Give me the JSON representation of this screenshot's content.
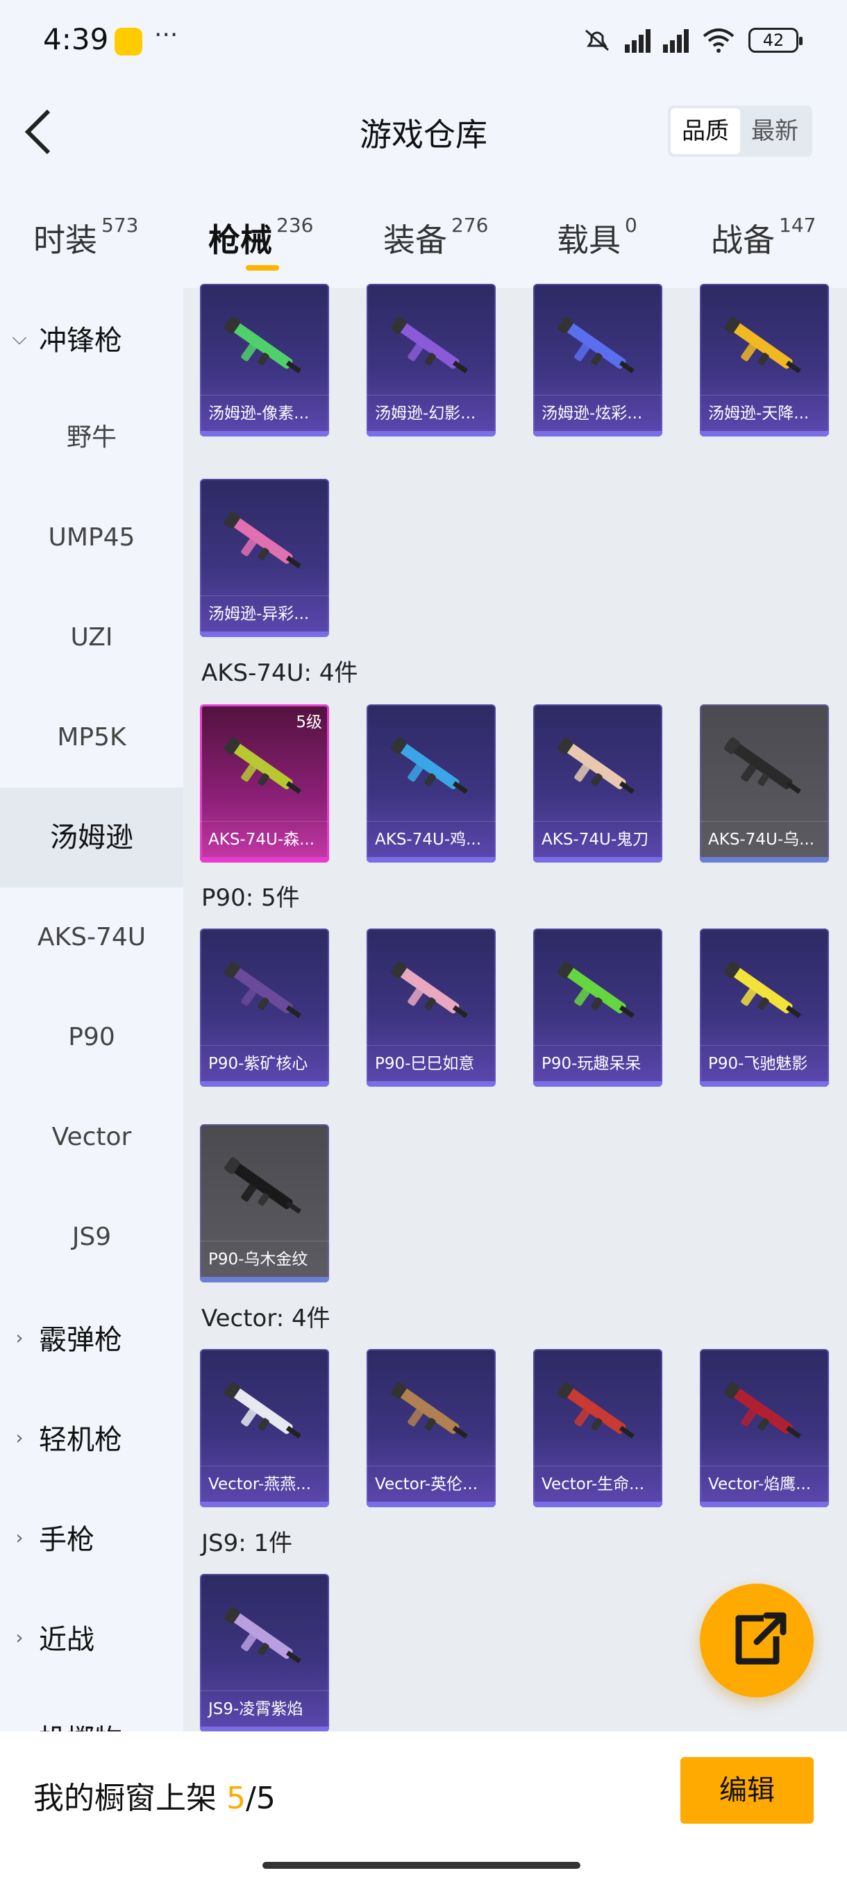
{
  "status_bar": {
    "time": "4:39",
    "dots": "···",
    "battery": "42"
  },
  "header": {
    "title": "游戏仓库",
    "sort_options": [
      "品质",
      "最新"
    ],
    "selected_sort": "品质"
  },
  "tabs": [
    {
      "label": "时装",
      "count": "573"
    },
    {
      "label": "枪械",
      "count": "236"
    },
    {
      "label": "装备",
      "count": "276"
    },
    {
      "label": "载具",
      "count": "0"
    },
    {
      "label": "战备",
      "count": "147"
    }
  ],
  "active_tab": "枪械",
  "sidebar": {
    "categories": [
      {
        "label": "冲锋枪",
        "expanded": true
      },
      {
        "label": "霰弹枪",
        "expanded": false
      },
      {
        "label": "轻机枪",
        "expanded": false
      },
      {
        "label": "手枪",
        "expanded": false
      },
      {
        "label": "近战",
        "expanded": false
      },
      {
        "label": "投掷物",
        "expanded": false
      }
    ],
    "subitems": [
      "野牛",
      "UMP45",
      "UZI",
      "MP5K",
      "汤姆逊",
      "AKS-74U",
      "P90",
      "Vector",
      "JS9"
    ],
    "active_subitem": "汤姆逊"
  },
  "groups": [
    {
      "label": "",
      "items": [
        {
          "name": "汤姆逊-像素...",
          "color": "#4fd06a",
          "frame": "purple"
        },
        {
          "name": "汤姆逊-幻影...",
          "color": "#8a5ad8",
          "frame": "purple"
        },
        {
          "name": "汤姆逊-炫彩...",
          "color": "#5a6ef0",
          "frame": "purple"
        },
        {
          "name": "汤姆逊-天降...",
          "color": "#f2b821",
          "frame": "purple"
        },
        {
          "name": "汤姆逊-异彩...",
          "color": "#e070b0",
          "frame": "purple"
        }
      ]
    },
    {
      "label": "AKS-74U: 4件",
      "items": [
        {
          "name": "AKS-74U-森...",
          "color": "#b8c832",
          "frame": "pink",
          "level": "5级"
        },
        {
          "name": "AKS-74U-鸡...",
          "color": "#3aa6e8",
          "frame": "purple"
        },
        {
          "name": "AKS-74U-鬼刀",
          "color": "#e8c9b0",
          "frame": "purple"
        },
        {
          "name": "AKS-74U-乌...",
          "color": "#2a2a2a",
          "frame": "gray"
        }
      ]
    },
    {
      "label": "P90: 5件",
      "items": [
        {
          "name": "P90-紫矿核心",
          "color": "#6a4a9a",
          "frame": "purple"
        },
        {
          "name": "P90-巳巳如意",
          "color": "#e8a8c0",
          "frame": "purple"
        },
        {
          "name": "P90-玩趣呆呆",
          "color": "#66d640",
          "frame": "purple"
        },
        {
          "name": "P90-飞驰魅影",
          "color": "#f2e23a",
          "frame": "purple"
        },
        {
          "name": "P90-乌木金纹",
          "color": "#1a1a1a",
          "frame": "gray"
        }
      ]
    },
    {
      "label": "Vector: 4件",
      "items": [
        {
          "name": "Vector-燕燕...",
          "color": "#e8e8f0",
          "frame": "purple"
        },
        {
          "name": "Vector-英伦...",
          "color": "#b08050",
          "frame": "purple"
        },
        {
          "name": "Vector-生命...",
          "color": "#c83a32",
          "frame": "purple"
        },
        {
          "name": "Vector-焰鹰...",
          "color": "#b02030",
          "frame": "purple"
        }
      ]
    },
    {
      "label": "JS9: 1件",
      "items": [
        {
          "name": "JS9-凌霄紫焰",
          "color": "#b8a0e0",
          "frame": "purple"
        }
      ]
    }
  ],
  "bottom": {
    "showcase_label": "我的橱窗上架",
    "showcase_used": "5",
    "showcase_sep": "/",
    "showcase_total": "5",
    "edit_label": "编辑"
  }
}
